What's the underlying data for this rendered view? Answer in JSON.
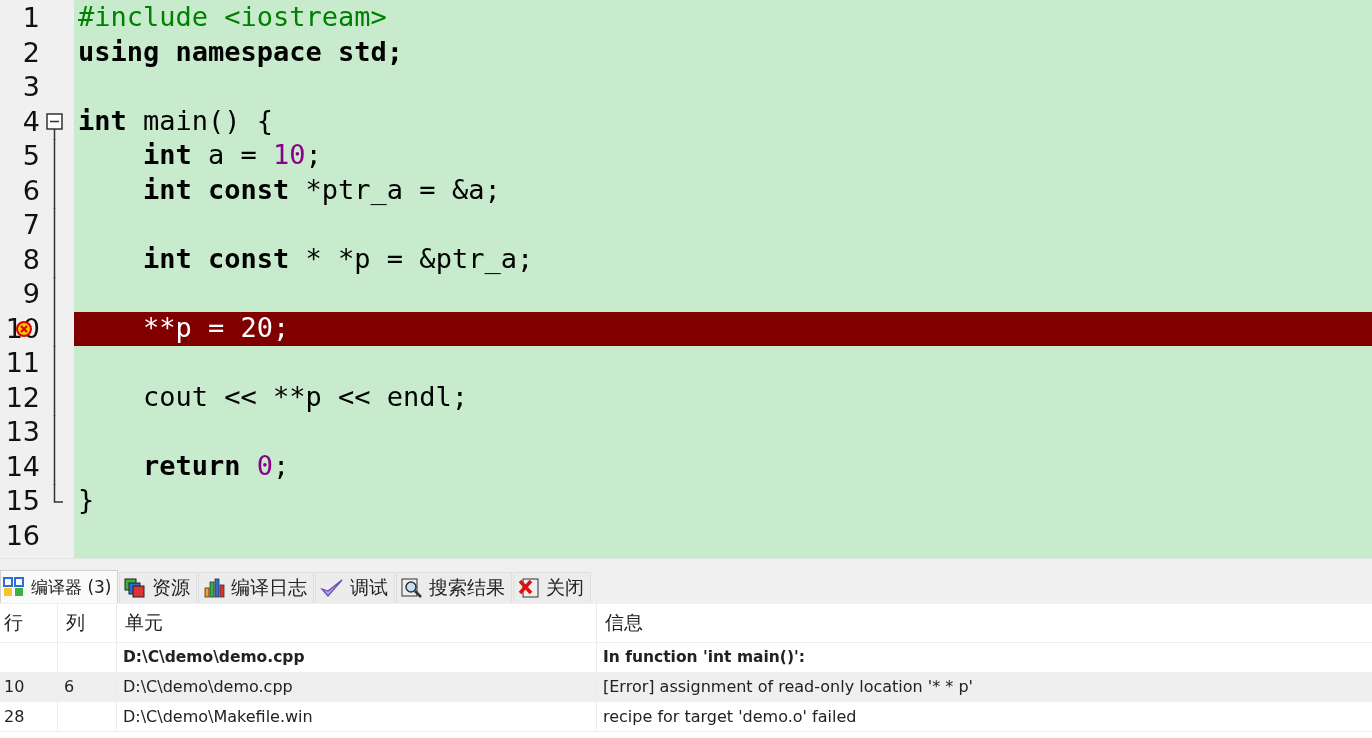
{
  "editor": {
    "lines": [
      {
        "number": "1",
        "kind": "plain",
        "error": false,
        "tokens": [
          {
            "text": "#include <iostream>",
            "kind": "pre"
          }
        ]
      },
      {
        "number": "2",
        "kind": "plain",
        "error": false,
        "tokens": [
          {
            "text": "using namespace std;",
            "kind": "kw"
          }
        ]
      },
      {
        "number": "3",
        "kind": "plain",
        "error": false
      },
      {
        "number": "4",
        "kind": "fold-start",
        "error": false,
        "tokens": [
          {
            "text": "int",
            "kind": "kw"
          },
          {
            "text": " main() {",
            "kind": "plain"
          }
        ]
      },
      {
        "number": "5",
        "kind": "fold-body",
        "error": false,
        "tokens": [
          {
            "text": "    int",
            "kind": "kw"
          },
          {
            "text": " a = ",
            "kind": "plain"
          },
          {
            "text": "10",
            "kind": "num"
          },
          {
            "text": ";",
            "kind": "plain"
          }
        ]
      },
      {
        "number": "6",
        "kind": "fold-body",
        "error": false,
        "tokens": [
          {
            "text": "    int const",
            "kind": "kw"
          },
          {
            "text": " *ptr_a = &a;",
            "kind": "plain"
          }
        ]
      },
      {
        "number": "7",
        "kind": "fold-body",
        "error": false
      },
      {
        "number": "8",
        "kind": "fold-body",
        "error": false,
        "tokens": [
          {
            "text": "    int const",
            "kind": "kw"
          },
          {
            "text": " * *p = &ptr_a;",
            "kind": "plain"
          }
        ]
      },
      {
        "number": "9",
        "kind": "fold-body",
        "error": false
      },
      {
        "number": "10",
        "kind": "fold-body",
        "error": true,
        "tokens": [
          {
            "text": "    **p = 20;",
            "kind": "plain"
          }
        ]
      },
      {
        "number": "11",
        "kind": "fold-body",
        "error": false
      },
      {
        "number": "12",
        "kind": "fold-body",
        "error": false,
        "tokens": [
          {
            "text": "    cout << **p << endl;",
            "kind": "plain"
          }
        ]
      },
      {
        "number": "13",
        "kind": "fold-body",
        "error": false
      },
      {
        "number": "14",
        "kind": "fold-body",
        "error": false,
        "tokens": [
          {
            "text": "    return",
            "kind": "kw"
          },
          {
            "text": " 0",
            "kind": "num"
          },
          {
            "text": ";",
            "kind": "plain"
          }
        ]
      },
      {
        "number": "15",
        "kind": "fold-end",
        "error": false,
        "tokens": [
          {
            "text": "}",
            "kind": "plain"
          }
        ]
      },
      {
        "number": "16",
        "kind": "plain",
        "error": false
      }
    ]
  },
  "tabs": [
    {
      "label": "编译器 (3)",
      "selected": true
    },
    {
      "label": "资源",
      "selected": false
    },
    {
      "label": "编译日志",
      "selected": false
    },
    {
      "label": "调试",
      "selected": false
    },
    {
      "label": "搜索结果",
      "selected": false
    },
    {
      "label": "关闭",
      "selected": false
    }
  ],
  "table": {
    "columns": [
      "行",
      "列",
      "单元",
      "信息"
    ],
    "rows": [
      {
        "kind": "heading",
        "selected": false,
        "cells": [
          "",
          "",
          "D:\\C\\demo\\demo.cpp",
          "In function 'int main()':"
        ]
      },
      {
        "kind": "message",
        "selected": true,
        "cells": [
          "10",
          "6",
          "D:\\C\\demo\\demo.cpp",
          "[Error] assignment of read-only location '* * p'"
        ]
      },
      {
        "kind": "message",
        "selected": false,
        "cells": [
          "28",
          "",
          "D:\\C\\demo\\Makefile.win",
          "recipe for target 'demo.o' failed"
        ]
      }
    ]
  }
}
